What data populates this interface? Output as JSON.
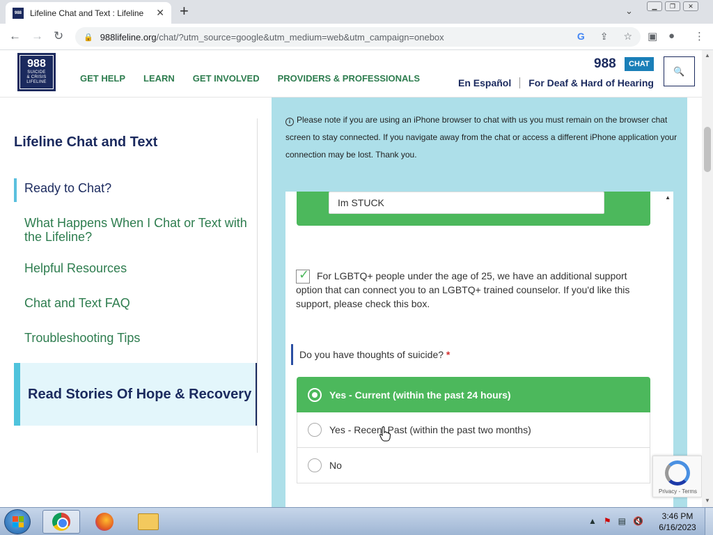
{
  "browser": {
    "tab_title": "Lifeline Chat and Text : Lifeline",
    "favicon_text": "988",
    "url_host": "988lifeline.org",
    "url_path": "/chat/?utm_source=google&utm_medium=web&utm_campaign=onebox",
    "icons": [
      "back-arrow-icon",
      "forward-arrow-icon",
      "reload-icon",
      "lock-icon",
      "google-icon",
      "share-icon",
      "star-icon",
      "sidebar-icon",
      "profile-icon",
      "menu-icon"
    ]
  },
  "header": {
    "logo_big": "988",
    "logo_small_1": "SUICIDE",
    "logo_small_2": "& CRISIS",
    "logo_small_3": "LIFELINE",
    "nav": [
      "GET HELP",
      "LEARN",
      "GET INVOLVED",
      "PROVIDERS & PROFESSIONALS"
    ],
    "brand_number": "988",
    "chat_badge": "CHAT",
    "espanol": "En Español",
    "deaf_link": "For Deaf & Hard of Hearing"
  },
  "sidebar": {
    "title": "Lifeline Chat and Text",
    "items": [
      {
        "label": "Ready to Chat?",
        "active": true
      },
      {
        "label": "What Happens When I Chat or Text with the Lifeline?"
      },
      {
        "label": "Helpful Resources"
      },
      {
        "label": "Chat and Text FAQ"
      },
      {
        "label": "Troubleshooting Tips"
      }
    ],
    "stories": "Read Stories Of Hope & Recovery"
  },
  "chat": {
    "notice": "Please note if you are using an iPhone browser to chat with us you must remain on the browser chat screen to stay connected. If you navigate away from the chat or access a different iPhone application your connection may be lost. Thank you.",
    "input_value": "Im STUCK",
    "lgbtq_checked": true,
    "lgbtq_text": "For LGBTQ+ people under the age of 25, we have an additional support option that can connect you to an LGBTQ+ trained counselor. If you'd like this support, please check this box.",
    "question": "Do you have thoughts of suicide?",
    "required_mark": "*",
    "options": [
      {
        "label": "Yes - Current (within the past 24 hours)",
        "selected": true
      },
      {
        "label": "Yes - Recent Past (within the past two months)",
        "selected": false
      },
      {
        "label": "No",
        "selected": false
      }
    ]
  },
  "recaptcha": {
    "links": "Privacy - Terms"
  },
  "taskbar": {
    "time": "3:46 PM",
    "date": "6/16/2023",
    "apps": [
      "chrome-icon",
      "firefox-icon",
      "file-explorer-icon"
    ]
  },
  "colors": {
    "navy": "#1b2a5e",
    "green": "#4cb85c",
    "nav_green": "#2e7d4f",
    "panel_blue": "#addfe9",
    "chat_badge": "#1a7fb8"
  }
}
